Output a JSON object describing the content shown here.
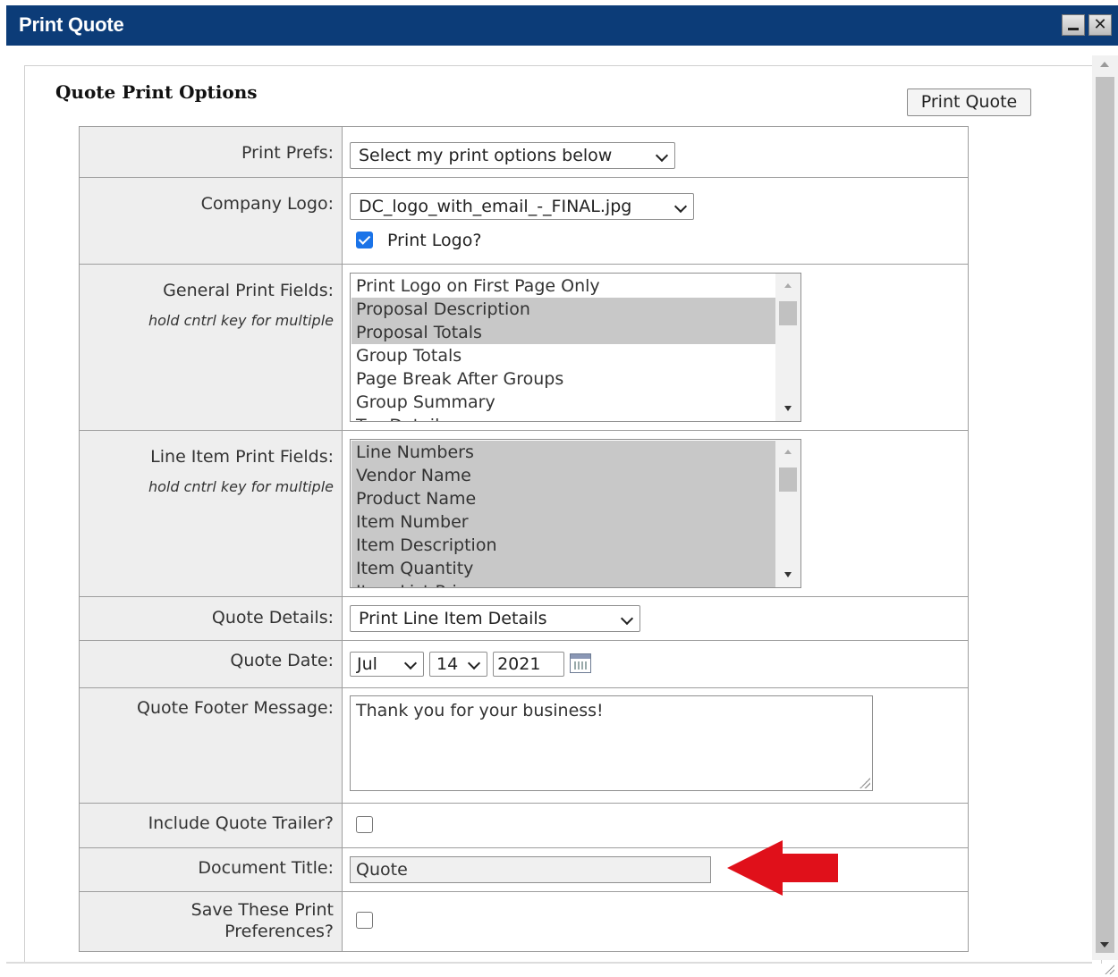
{
  "window": {
    "title": "Print Quote",
    "minimize_glyph": "",
    "close_glyph": "✕"
  },
  "header": {
    "section_title": "Quote Print Options",
    "print_button": "Print Quote"
  },
  "form": {
    "print_prefs": {
      "label": "Print Prefs:",
      "value": "Select my print options below"
    },
    "company_logo": {
      "label": "Company Logo:",
      "value": "DC_logo_with_email_-_FINAL.jpg",
      "print_logo_label": "Print Logo?",
      "print_logo_checked": true
    },
    "general_fields": {
      "label": "General Print Fields:",
      "hint": "hold cntrl key for multiple",
      "items": [
        {
          "text": "Print Logo on First Page Only",
          "selected": false
        },
        {
          "text": "Proposal Description",
          "selected": true
        },
        {
          "text": "Proposal Totals",
          "selected": true
        },
        {
          "text": "Group Totals",
          "selected": false
        },
        {
          "text": "Page Break After Groups",
          "selected": false
        },
        {
          "text": "Group Summary",
          "selected": false
        },
        {
          "text": "Tax Details",
          "selected": false
        }
      ]
    },
    "line_item_fields": {
      "label": "Line Item Print Fields:",
      "hint": "hold cntrl key for multiple",
      "items": [
        {
          "text": "Line Numbers",
          "selected": true
        },
        {
          "text": "Vendor Name",
          "selected": true
        },
        {
          "text": "Product Name",
          "selected": true
        },
        {
          "text": "Item Number",
          "selected": true
        },
        {
          "text": "Item Description",
          "selected": true
        },
        {
          "text": "Item Quantity",
          "selected": true
        },
        {
          "text": "Item List Price",
          "selected": true
        }
      ]
    },
    "quote_details": {
      "label": "Quote Details:",
      "value": "Print Line Item Details"
    },
    "quote_date": {
      "label": "Quote Date:",
      "month": "Jul",
      "day": "14",
      "year": "2021"
    },
    "footer_message": {
      "label": "Quote Footer Message:",
      "value": "Thank you for your business!"
    },
    "include_trailer": {
      "label": "Include Quote Trailer?",
      "checked": false
    },
    "document_title": {
      "label": "Document Title:",
      "value": "Quote"
    },
    "save_prefs": {
      "label_line1": "Save These Print",
      "label_line2": "Preferences?",
      "checked": false
    }
  },
  "colors": {
    "titlebar": "#0c3c78",
    "annotation_arrow": "#e0101a",
    "selected_item": "#c8c8c8",
    "checkbox_checked": "#1a73e8"
  }
}
